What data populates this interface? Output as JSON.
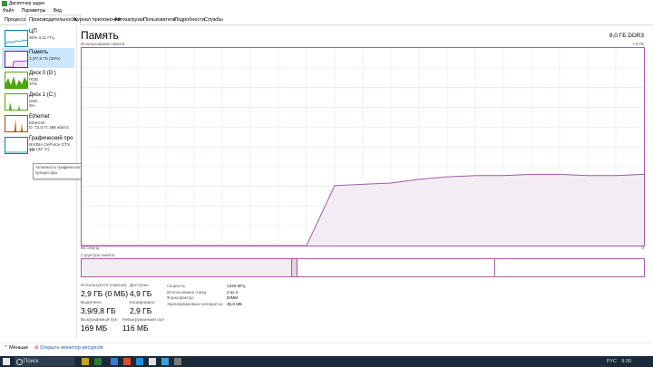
{
  "window": {
    "title": "Диспетчер задач"
  },
  "menu": [
    "Файл",
    "Параметры",
    "Вид"
  ],
  "tabs": [
    "Процессы",
    "Производительность",
    "Журнал приложений",
    "Автозагрузка",
    "Пользователи",
    "Подробности",
    "Службы"
  ],
  "active_tab": 1,
  "sidebar": [
    {
      "title": "ЦП",
      "sub1": "30%  3,11 ГГц",
      "sub2": "",
      "color": "#117dbb"
    },
    {
      "title": "Память",
      "sub1": "3,0/7,9 ГБ (38%)",
      "sub2": "",
      "color": "#8b12ae"
    },
    {
      "title": "Диск 0 (D:)",
      "sub1": "HDD",
      "sub2": "37%",
      "color": "#4da60c"
    },
    {
      "title": "Диск 1 (C:)",
      "sub1": "SSD",
      "sub2": "3%",
      "color": "#4da60c"
    },
    {
      "title": "Ethernet",
      "sub1": "Ethernet",
      "sub2": "О: 72,0  П: 288 кбит/с",
      "color": "#a74f01"
    },
    {
      "title": "Графический про",
      "sub1": "NVIDIA GeForce GTX 10!",
      "sub2": "1% (33 °C)",
      "color": "#008299"
    }
  ],
  "tooltip": "Активность графического процессора",
  "memory": {
    "title": "Память",
    "spec": "8,0 ГБ DDR3",
    "graph_label": "Использование памяти",
    "graph_max": "7,9 ГБ",
    "axis_left": "60 секунд",
    "axis_right": "0",
    "structure_label": "Структура памяти",
    "accent": "#a65aa8",
    "fill": "#f4ecf4",
    "usage_fraction": 0.38
  },
  "chart_data": {
    "type": "area",
    "x": [
      60,
      57,
      54,
      51,
      48,
      45,
      42,
      39,
      36,
      33,
      30,
      27,
      24,
      21,
      18,
      15,
      12,
      9,
      6,
      3,
      0
    ],
    "series": [
      {
        "values": [
          0,
          0,
          0,
          0,
          0,
          0,
          0,
          0,
          0,
          2.4,
          2.45,
          2.5,
          2.65,
          2.75,
          2.8,
          2.8,
          2.85,
          2.85,
          2.8,
          2.8,
          2.85
        ]
      }
    ],
    "ylim": [
      0,
      7.9
    ],
    "grid": true
  },
  "stats": [
    {
      "label": "Используется (сжатая)",
      "value": "2,9 ГБ (0 МБ)"
    },
    {
      "label": "Доступно",
      "value": "4,9 ГБ"
    },
    {
      "label": "Выделено",
      "value": "3,9/9,8 ГБ"
    },
    {
      "label": "Кэшировано",
      "value": "2,9 ГБ"
    },
    {
      "label": "Выгружаемый пул",
      "value": "169 МБ"
    },
    {
      "label": "Невыгружаемый пул",
      "value": "116 МБ"
    }
  ],
  "details": [
    {
      "label": "Скорость:",
      "value": "1333 МГц"
    },
    {
      "label": "Использовано гнезд:",
      "value": "2 из 2"
    },
    {
      "label": "Форм-фактор:",
      "value": "DIMM"
    },
    {
      "label": "Зарезервировано аппаратно:",
      "value": "35,8 МБ"
    }
  ],
  "bottom": {
    "less": "Меньше",
    "resmon": "Открыть монитор ресурсов"
  },
  "taskbar": {
    "search": "Поиск",
    "lang": "РУС",
    "time": "9:30"
  }
}
